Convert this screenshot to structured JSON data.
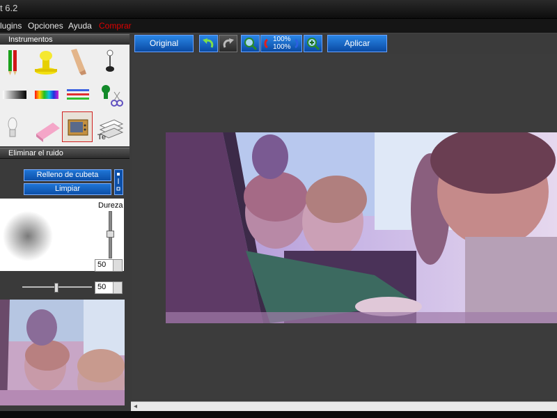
{
  "window": {
    "title": "t 6.2"
  },
  "menu": {
    "items": [
      "lugins",
      "Opciones",
      "Ayuda"
    ],
    "highlight": "Comprar"
  },
  "tools_panel": {
    "title": "Instrumentos"
  },
  "filter_panel": {
    "title": "Eliminar el ruido",
    "fill_button": "Relleno de cubeta",
    "clear_button": "Limpiar",
    "hardness_label": "Dureza",
    "hardness_value": "50",
    "size_value": "50"
  },
  "toolbar": {
    "original_label": "Original",
    "zoom_top": "100%",
    "zoom_bottom": "100%",
    "apply_label": "Aplicar"
  },
  "colors": {
    "accent": "#1565c0",
    "menu_highlight": "#e00000",
    "workspace": "#3c3c3c"
  }
}
